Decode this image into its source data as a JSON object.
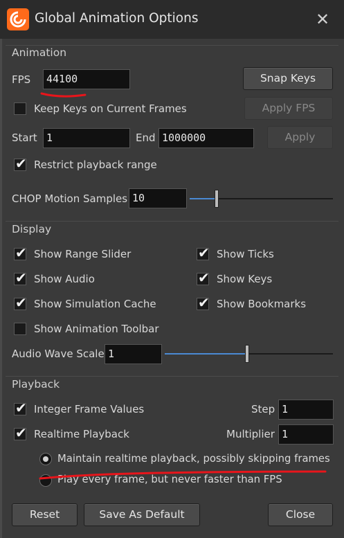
{
  "window": {
    "title": "Global Animation Options",
    "logo_icon": "houdini-logo-icon",
    "close_icon": "close-x-icon"
  },
  "animation": {
    "section_label": "Animation",
    "fps_label": "FPS",
    "fps_value": "44100",
    "snap_keys_label": "Snap Keys",
    "keep_keys_label": "Keep Keys on Current Frames",
    "keep_keys_checked": false,
    "apply_fps_label": "Apply FPS",
    "start_label": "Start",
    "start_value": "1",
    "end_label": "End",
    "end_value": "1000000",
    "apply_label": "Apply",
    "restrict_label": "Restrict playback range",
    "restrict_checked": true,
    "chop_label": "CHOP Motion Samples",
    "chop_value": "10",
    "chop_slider_level": 0.19
  },
  "display": {
    "section_label": "Display",
    "show_range_slider": "Show Range Slider",
    "show_ticks": "Show Ticks",
    "show_audio": "Show Audio",
    "show_keys": "Show Keys",
    "show_sim_cache": "Show Simulation Cache",
    "show_bookmarks": "Show Bookmarks",
    "show_anim_toolbar": "Show Animation Toolbar",
    "audio_wave_label": "Audio Wave Scale",
    "audio_wave_value": "1",
    "audio_wave_slider_level": 0.49
  },
  "playback": {
    "section_label": "Playback",
    "integer_frames_label": "Integer Frame Values",
    "step_label": "Step",
    "step_value": "1",
    "realtime_label": "Realtime Playback",
    "multiplier_label": "Multiplier",
    "multiplier_value": "1",
    "radio_skip_label": "Maintain realtime playback, possibly skipping frames",
    "radio_every_label": "Play every frame, but never faster than FPS"
  },
  "footer": {
    "reset_label": "Reset",
    "save_default_label": "Save As Default",
    "close_label": "Close"
  },
  "colors": {
    "accent_blue": "#4a8ad4",
    "annotation_red": "#e8151b",
    "background": "#3a3a3a",
    "titlebar": "#2b2b2b"
  }
}
